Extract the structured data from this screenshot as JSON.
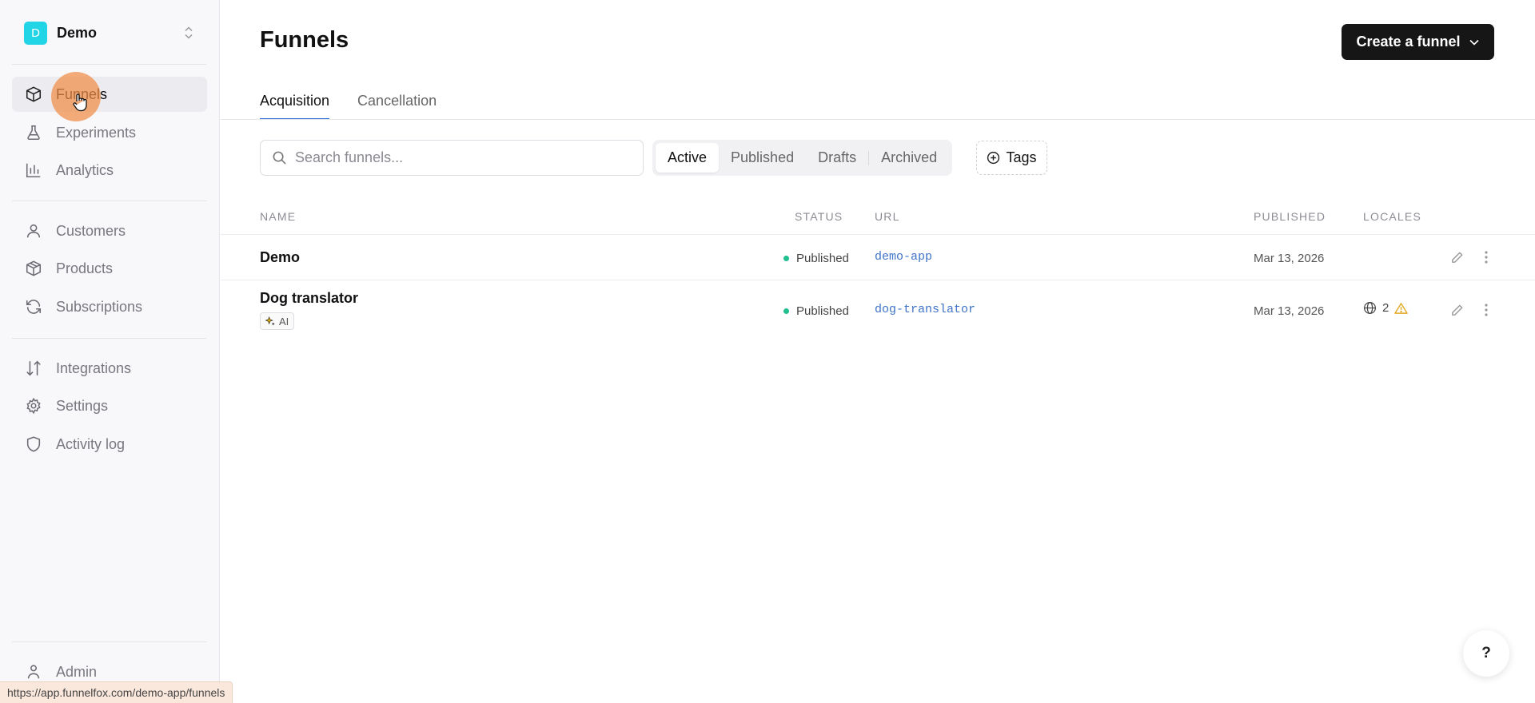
{
  "workspace": {
    "initial": "D",
    "name": "Demo"
  },
  "sidebar": {
    "items": [
      {
        "label": "Funnels",
        "icon": "box-icon"
      },
      {
        "label": "Experiments",
        "icon": "flask-icon"
      },
      {
        "label": "Analytics",
        "icon": "bar-chart-icon"
      },
      {
        "label": "Customers",
        "icon": "user-icon"
      },
      {
        "label": "Products",
        "icon": "package-icon"
      },
      {
        "label": "Subscriptions",
        "icon": "refresh-icon"
      },
      {
        "label": "Integrations",
        "icon": "arrows-updown-icon"
      },
      {
        "label": "Settings",
        "icon": "gear-icon"
      },
      {
        "label": "Activity log",
        "icon": "shield-icon"
      },
      {
        "label": "Admin",
        "icon": "admin-icon"
      }
    ]
  },
  "status_url": "https://app.funnelfox.com/demo-app/funnels",
  "header": {
    "title": "Funnels",
    "create_label": "Create a funnel"
  },
  "tabs": [
    {
      "label": "Acquisition"
    },
    {
      "label": "Cancellation"
    }
  ],
  "search": {
    "placeholder": "Search funnels..."
  },
  "filters": [
    {
      "label": "Active"
    },
    {
      "label": "Published"
    },
    {
      "label": "Drafts"
    },
    {
      "label": "Archived"
    }
  ],
  "tags_label": "Tags",
  "table": {
    "columns": [
      "NAME",
      "STATUS",
      "URL",
      "PUBLISHED",
      "LOCALES"
    ],
    "rows": [
      {
        "name": "Demo",
        "status": "Published",
        "url": "demo-app",
        "published": "Mar 13, 2026"
      },
      {
        "name": "Dog translator",
        "badge": "AI",
        "status": "Published",
        "url": "dog-translator",
        "published": "Mar 13, 2026",
        "locales": "2"
      }
    ]
  },
  "help_label": "?",
  "colors": {
    "accent": "#2f6fd6",
    "status_published": "#1fbf8f",
    "workspace_avatar": "#21d4e6",
    "warning": "#e5a823"
  }
}
